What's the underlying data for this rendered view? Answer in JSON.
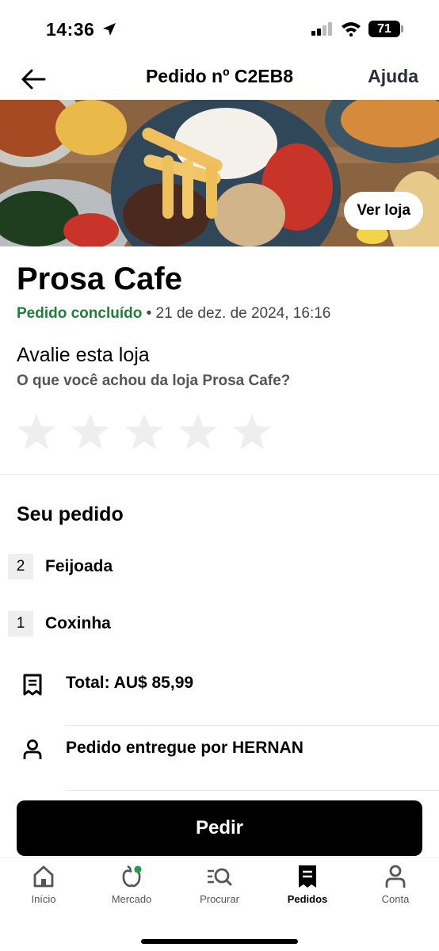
{
  "status_bar": {
    "time": "14:36",
    "battery": "71"
  },
  "header": {
    "title": "Pedido nº C2EB8",
    "help_label": "Ajuda",
    "back_icon": "arrow-left-icon"
  },
  "hero": {
    "view_store_label": "Ver loja"
  },
  "store": {
    "name": "Prosa Cafe",
    "status": "Pedido concluído",
    "date": " • 21 de dez. de 2024, 16:16"
  },
  "rating": {
    "title": "Avalie esta loja",
    "subtitle": "O que você achou da loja Prosa Cafe?",
    "stars": 5,
    "selected": 0,
    "star_color": "#eeeeee"
  },
  "order": {
    "title": "Seu pedido",
    "items": [
      {
        "qty": "2",
        "name": "Feijoada"
      },
      {
        "qty": "1",
        "name": "Coxinha"
      }
    ],
    "total": "Total: AU$ 85,99",
    "delivered_by": "Pedido entregue por HERNAN"
  },
  "cta": {
    "label": "Pedir"
  },
  "tabs": [
    {
      "label": "Início",
      "icon": "home-icon"
    },
    {
      "label": "Mercado",
      "icon": "grocery-icon"
    },
    {
      "label": "Procurar",
      "icon": "search-icon"
    },
    {
      "label": "Pedidos",
      "icon": "receipt-icon",
      "active": true
    },
    {
      "label": "Conta",
      "icon": "person-icon"
    }
  ],
  "colors": {
    "accent_green": "#1e7f3a",
    "primary": "#000000"
  }
}
